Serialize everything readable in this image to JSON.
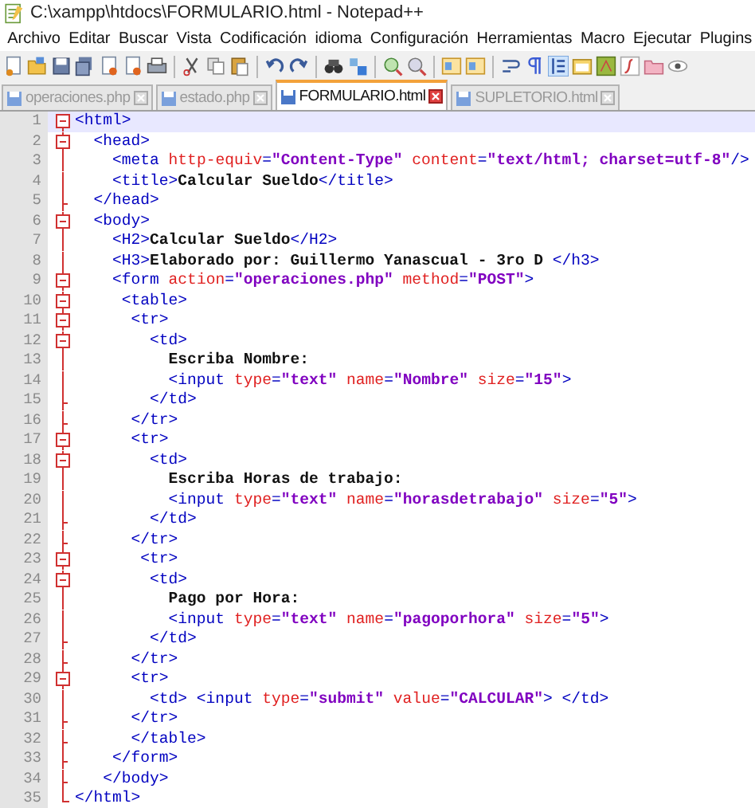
{
  "window": {
    "title": "C:\\xampp\\htdocs\\FORMULARIO.html - Notepad++"
  },
  "menu": [
    "Archivo",
    "Editar",
    "Buscar",
    "Vista",
    "Codificación",
    "idioma",
    "Configuración",
    "Herramientas",
    "Macro",
    "Ejecutar",
    "Plugins"
  ],
  "tabs": [
    {
      "label": "operaciones.php",
      "selected": false
    },
    {
      "label": "estado.php",
      "selected": false
    },
    {
      "label": "FORMULARIO.html",
      "selected": true
    },
    {
      "label": "SUPLETORIO.html",
      "selected": false
    }
  ],
  "editor": {
    "lines": [
      {
        "number": "1",
        "kind": "open",
        "current": true,
        "tokens": [
          {
            "kind": "tag",
            "text": "<html>"
          }
        ]
      },
      {
        "number": "2",
        "kind": "open",
        "current": false,
        "tokens": [
          {
            "kind": "tag",
            "text": "  <head>"
          }
        ]
      },
      {
        "number": "3",
        "kind": "line",
        "current": false,
        "tokens": [
          {
            "kind": "tag",
            "text": "    <meta"
          },
          {
            "kind": "attr",
            "text": " http-equiv"
          },
          {
            "kind": "tag",
            "text": "="
          },
          {
            "kind": "value",
            "text": "\"Content-Type\""
          },
          {
            "kind": "attr",
            "text": " content"
          },
          {
            "kind": "tag",
            "text": "="
          },
          {
            "kind": "value",
            "text": "\"text/html; charset=utf-8\""
          },
          {
            "kind": "tag",
            "text": "/>"
          }
        ]
      },
      {
        "number": "4",
        "kind": "line",
        "current": false,
        "tokens": [
          {
            "kind": "tag",
            "text": "    <title>"
          },
          {
            "kind": "text",
            "text": "Calcular Sueldo"
          },
          {
            "kind": "tag",
            "text": "</title>"
          }
        ]
      },
      {
        "number": "5",
        "kind": "tick",
        "current": false,
        "tokens": [
          {
            "kind": "tag",
            "text": "  </head>"
          }
        ]
      },
      {
        "number": "6",
        "kind": "open",
        "current": false,
        "tokens": [
          {
            "kind": "tag",
            "text": "  <body>"
          }
        ]
      },
      {
        "number": "7",
        "kind": "line",
        "current": false,
        "tokens": [
          {
            "kind": "tag",
            "text": "    <H2>"
          },
          {
            "kind": "text",
            "text": "Calcular Sueldo"
          },
          {
            "kind": "tag",
            "text": "</H2>"
          }
        ]
      },
      {
        "number": "8",
        "kind": "line",
        "current": false,
        "tokens": [
          {
            "kind": "tag",
            "text": "    <H3>"
          },
          {
            "kind": "text",
            "text": "Elaborado por: Guillermo Yanascual - 3ro D "
          },
          {
            "kind": "tag",
            "text": "</h3>"
          }
        ]
      },
      {
        "number": "9",
        "kind": "open",
        "current": false,
        "tokens": [
          {
            "kind": "tag",
            "text": "    <form"
          },
          {
            "kind": "attr",
            "text": " action"
          },
          {
            "kind": "tag",
            "text": "="
          },
          {
            "kind": "value",
            "text": "\"operaciones.php\""
          },
          {
            "kind": "attr",
            "text": " method"
          },
          {
            "kind": "tag",
            "text": "="
          },
          {
            "kind": "value",
            "text": "\"POST\""
          },
          {
            "kind": "tag",
            "text": ">"
          }
        ]
      },
      {
        "number": "10",
        "kind": "open",
        "current": false,
        "tokens": [
          {
            "kind": "tag",
            "text": "     <table>"
          }
        ]
      },
      {
        "number": "11",
        "kind": "open",
        "current": false,
        "tokens": [
          {
            "kind": "tag",
            "text": "      <tr>"
          }
        ]
      },
      {
        "number": "12",
        "kind": "open",
        "current": false,
        "tokens": [
          {
            "kind": "tag",
            "text": "        <td>"
          }
        ]
      },
      {
        "number": "13",
        "kind": "line",
        "current": false,
        "tokens": [
          {
            "kind": "text",
            "text": "          Escriba Nombre:"
          }
        ]
      },
      {
        "number": "14",
        "kind": "line",
        "current": false,
        "tokens": [
          {
            "kind": "tag",
            "text": "          <input"
          },
          {
            "kind": "attr",
            "text": " type"
          },
          {
            "kind": "tag",
            "text": "="
          },
          {
            "kind": "value",
            "text": "\"text\""
          },
          {
            "kind": "attr",
            "text": " name"
          },
          {
            "kind": "tag",
            "text": "="
          },
          {
            "kind": "value",
            "text": "\"Nombre\""
          },
          {
            "kind": "attr",
            "text": " size"
          },
          {
            "kind": "tag",
            "text": "="
          },
          {
            "kind": "value",
            "text": "\"15\""
          },
          {
            "kind": "tag",
            "text": ">"
          }
        ]
      },
      {
        "number": "15",
        "kind": "tick",
        "current": false,
        "tokens": [
          {
            "kind": "tag",
            "text": "        </td>"
          }
        ]
      },
      {
        "number": "16",
        "kind": "tick",
        "current": false,
        "tokens": [
          {
            "kind": "tag",
            "text": "      </tr>"
          }
        ]
      },
      {
        "number": "17",
        "kind": "open",
        "current": false,
        "tokens": [
          {
            "kind": "tag",
            "text": "      <tr>"
          }
        ]
      },
      {
        "number": "18",
        "kind": "open",
        "current": false,
        "tokens": [
          {
            "kind": "tag",
            "text": "        <td>"
          }
        ]
      },
      {
        "number": "19",
        "kind": "line",
        "current": false,
        "tokens": [
          {
            "kind": "text",
            "text": "          Escriba Horas de trabajo:"
          }
        ]
      },
      {
        "number": "20",
        "kind": "line",
        "current": false,
        "tokens": [
          {
            "kind": "tag",
            "text": "          <input"
          },
          {
            "kind": "attr",
            "text": " type"
          },
          {
            "kind": "tag",
            "text": "="
          },
          {
            "kind": "value",
            "text": "\"text\""
          },
          {
            "kind": "attr",
            "text": " name"
          },
          {
            "kind": "tag",
            "text": "="
          },
          {
            "kind": "value",
            "text": "\"horasdetrabajo\""
          },
          {
            "kind": "attr",
            "text": " size"
          },
          {
            "kind": "tag",
            "text": "="
          },
          {
            "kind": "value",
            "text": "\"5\""
          },
          {
            "kind": "tag",
            "text": ">"
          }
        ]
      },
      {
        "number": "21",
        "kind": "tick",
        "current": false,
        "tokens": [
          {
            "kind": "tag",
            "text": "        </td>"
          }
        ]
      },
      {
        "number": "22",
        "kind": "tick",
        "current": false,
        "tokens": [
          {
            "kind": "tag",
            "text": "      </tr>"
          }
        ]
      },
      {
        "number": "23",
        "kind": "open",
        "current": false,
        "tokens": [
          {
            "kind": "tag",
            "text": "       <tr>"
          }
        ]
      },
      {
        "number": "24",
        "kind": "open",
        "current": false,
        "tokens": [
          {
            "kind": "tag",
            "text": "        <td>"
          }
        ]
      },
      {
        "number": "25",
        "kind": "line",
        "current": false,
        "tokens": [
          {
            "kind": "text",
            "text": "          Pago por Hora:"
          }
        ]
      },
      {
        "number": "26",
        "kind": "line",
        "current": false,
        "tokens": [
          {
            "kind": "tag",
            "text": "          <input"
          },
          {
            "kind": "attr",
            "text": " type"
          },
          {
            "kind": "tag",
            "text": "="
          },
          {
            "kind": "value",
            "text": "\"text\""
          },
          {
            "kind": "attr",
            "text": " name"
          },
          {
            "kind": "tag",
            "text": "="
          },
          {
            "kind": "value",
            "text": "\"pagoporhora\""
          },
          {
            "kind": "attr",
            "text": " size"
          },
          {
            "kind": "tag",
            "text": "="
          },
          {
            "kind": "value",
            "text": "\"5\""
          },
          {
            "kind": "tag",
            "text": ">"
          }
        ]
      },
      {
        "number": "27",
        "kind": "tick",
        "current": false,
        "tokens": [
          {
            "kind": "tag",
            "text": "        </td>"
          }
        ]
      },
      {
        "number": "28",
        "kind": "tick",
        "current": false,
        "tokens": [
          {
            "kind": "tag",
            "text": "      </tr>"
          }
        ]
      },
      {
        "number": "29",
        "kind": "open",
        "current": false,
        "tokens": [
          {
            "kind": "tag",
            "text": "      <tr>"
          }
        ]
      },
      {
        "number": "30",
        "kind": "line",
        "current": false,
        "tokens": [
          {
            "kind": "tag",
            "text": "        <td> <input"
          },
          {
            "kind": "attr",
            "text": " type"
          },
          {
            "kind": "tag",
            "text": "="
          },
          {
            "kind": "value",
            "text": "\"submit\""
          },
          {
            "kind": "attr",
            "text": " value"
          },
          {
            "kind": "tag",
            "text": "="
          },
          {
            "kind": "value",
            "text": "\"CALCULAR\""
          },
          {
            "kind": "tag",
            "text": "> </td>"
          }
        ]
      },
      {
        "number": "31",
        "kind": "tick",
        "current": false,
        "tokens": [
          {
            "kind": "tag",
            "text": "      </tr>"
          }
        ]
      },
      {
        "number": "32",
        "kind": "tick",
        "current": false,
        "tokens": [
          {
            "kind": "tag",
            "text": "      </table>"
          }
        ]
      },
      {
        "number": "33",
        "kind": "tick",
        "current": false,
        "tokens": [
          {
            "kind": "tag",
            "text": "    </form>"
          }
        ]
      },
      {
        "number": "34",
        "kind": "tick",
        "current": false,
        "tokens": [
          {
            "kind": "tag",
            "text": "   </body>"
          }
        ]
      },
      {
        "number": "35",
        "kind": "end",
        "current": false,
        "tokens": [
          {
            "kind": "tag",
            "text": "</html>"
          }
        ]
      }
    ]
  }
}
